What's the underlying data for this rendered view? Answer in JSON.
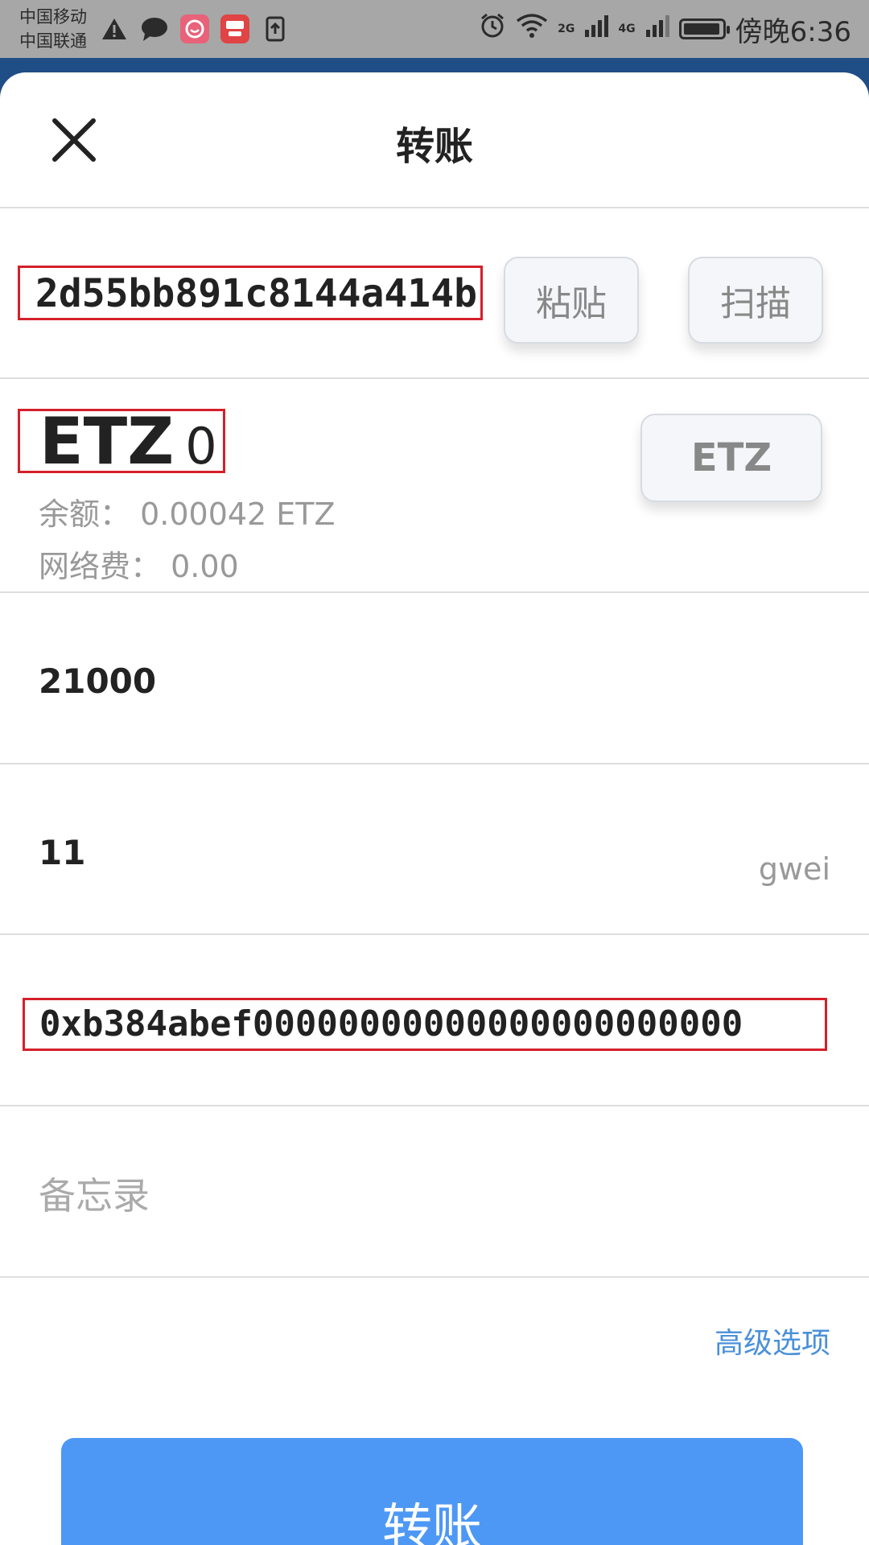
{
  "status_bar": {
    "carrier_1": "中国移动",
    "carrier_2": "中国联通",
    "net_1": "2G",
    "net_2": "4G",
    "time": "傍晚6:36",
    "battery_level": 0.95,
    "icons": [
      "warning-icon",
      "chat-icon",
      "app-pink-icon",
      "dingdang-icon",
      "upload-icon",
      "alarm-icon",
      "wifi-icon",
      "signal-icon",
      "battery-icon"
    ]
  },
  "header": {
    "title": "转账"
  },
  "recipient": {
    "address": "2d55bb891c8144a414b",
    "paste_label": "粘贴",
    "scan_label": "扫描"
  },
  "amount": {
    "coin": "ETZ",
    "value": "0",
    "balance": "余额： 0.00042 ETZ",
    "fee": "网络费： 0.00",
    "coin_select_label": "ETZ"
  },
  "gas_limit": {
    "value": "21000"
  },
  "gas_price": {
    "value": "11",
    "unit": "gwei"
  },
  "data_field": {
    "value": "0xb384abef00000000000000000000000"
  },
  "memo": {
    "placeholder": "备忘录"
  },
  "advanced_label": "高级选项",
  "submit_label": "转账",
  "colors": {
    "accent": "#4d98f5",
    "link": "#4a90d9",
    "highlight": "#d4202a"
  }
}
